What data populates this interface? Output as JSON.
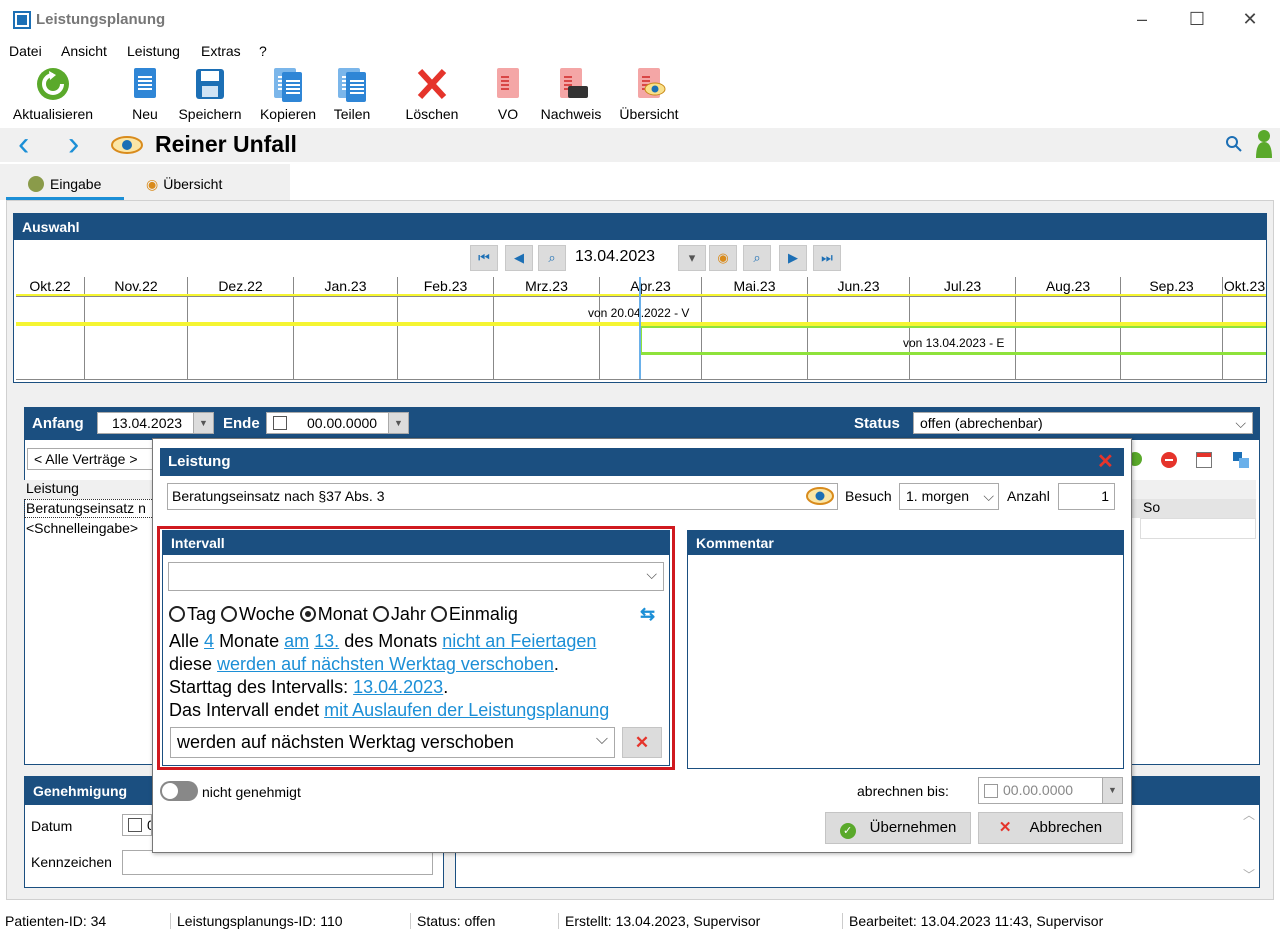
{
  "window": {
    "title": "Leistungsplanung",
    "min": "–",
    "max": "☐",
    "close": "✕"
  },
  "menu": [
    "Datei",
    "Ansicht",
    "Leistung",
    "Extras",
    "?"
  ],
  "toolbar": [
    "Aktualisieren",
    "Neu",
    "Speichern",
    "Kopieren",
    "Teilen",
    "Löschen",
    "VO",
    "Nachweis",
    "Übersicht"
  ],
  "nav": {
    "title": "Reiner Unfall",
    "back": "‹",
    "forward": "›"
  },
  "tabs": [
    "Eingabe",
    "Übersicht"
  ],
  "auswahl": {
    "title": "Auswahl",
    "date": "13.04.2023",
    "months": [
      "Okt.22",
      "Nov.22",
      "Dez.22",
      "Jan.23",
      "Feb.23",
      "Mrz.23",
      "Apr.23",
      "Mai.23",
      "Jun.23",
      "Jul.23",
      "Aug.23",
      "Sep.23",
      "Okt.23"
    ],
    "bar1": "von 20.04.2022 - V",
    "bar2": "von 13.04.2023 - E",
    "colors": {
      "bar1": "#f5f532",
      "bar2": "#8ee23b"
    }
  },
  "form": {
    "anfang_label": "Anfang",
    "anfang_value": "13.04.2023",
    "ende_label": "Ende",
    "ende_value": "00.00.0000",
    "status_label": "Status",
    "status_value": "offen (abrechenbar)",
    "vertraege": "< Alle Verträge >",
    "table_header": "Leistung",
    "rows": [
      "Beratungseinsatz n",
      "<Schnelleingabe>"
    ],
    "so_header": "So"
  },
  "genehmigung": {
    "title": "Genehmigung",
    "datum": "Datum",
    "datum_val": "0",
    "kennzeichen": "Kennzeichen"
  },
  "dialog": {
    "title": "Leistung",
    "leistung": "Beratungseinsatz nach §37 Abs. 3",
    "besuch_label": "Besuch",
    "besuch_value": "1. morgen",
    "anzahl_label": "Anzahl",
    "anzahl_value": "1",
    "intervall": {
      "title": "Intervall",
      "select": "",
      "options": [
        "Tag",
        "Woche",
        "Monat",
        "Jahr",
        "Einmalig"
      ],
      "selected": "Monat",
      "l1": [
        "Alle",
        "4",
        "Monate",
        "am",
        "13.",
        "des Monats",
        "nicht an Feiertagen"
      ],
      "l2": [
        "diese",
        "werden auf nächsten Werktag verschoben",
        "."
      ],
      "l3": [
        "Starttag des Intervalls:",
        "13.04.2023",
        "."
      ],
      "l4": [
        "Das Intervall endet",
        "mit Auslaufen der Leistungsplanung"
      ],
      "dropdown": "werden auf nächsten Werktag verschoben"
    },
    "kommentar": "Kommentar",
    "toggle": "nicht genehmigt",
    "abrechnen_label": "abrechnen bis:",
    "abrechnen_value": "00.00.0000",
    "ok": "Übernehmen",
    "cancel": "Abbrechen"
  },
  "status": [
    "Patienten-ID: 34",
    "Leistungsplanungs-ID: 110",
    "Status: offen",
    "Erstellt: 13.04.2023, Supervisor",
    "Bearbeitet: 13.04.2023 11:43, Supervisor"
  ]
}
